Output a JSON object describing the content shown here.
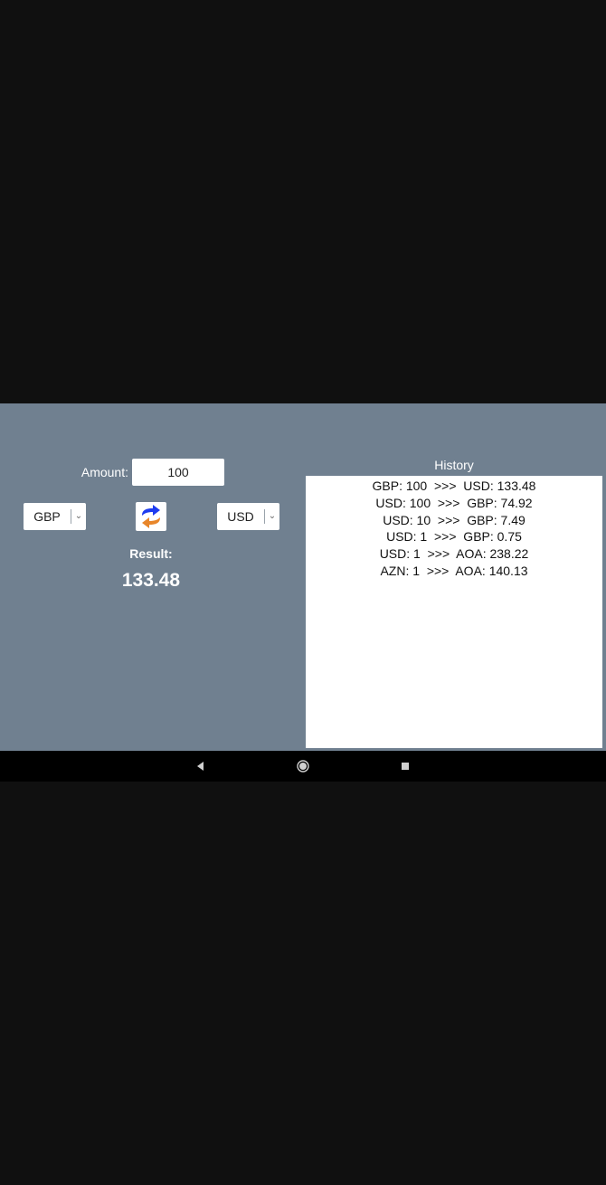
{
  "converter": {
    "amount_label": "Amount:",
    "amount_value": "100",
    "from_currency": "GBP",
    "to_currency": "USD",
    "swap_icon": "swap-arrows-icon",
    "result_label": "Result:",
    "result_value": "133.48"
  },
  "history": {
    "title": "History",
    "entries": [
      "GBP: 100  >>>  USD: 133.48",
      "USD: 100  >>>  GBP: 74.92",
      "USD: 10  >>>  GBP: 7.49",
      "USD: 1  >>>  GBP: 0.75",
      "USD: 1  >>>  AOA: 238.22",
      "AZN: 1  >>>  AOA: 140.13"
    ]
  },
  "navbar": {
    "back_icon": "back-triangle-icon",
    "home_icon": "home-circle-icon",
    "recents_icon": "recents-square-icon"
  },
  "colors": {
    "app_background": "#708090",
    "screen_background": "#101010",
    "swap_blue": "#1e3cf0",
    "swap_orange": "#e8862a"
  }
}
